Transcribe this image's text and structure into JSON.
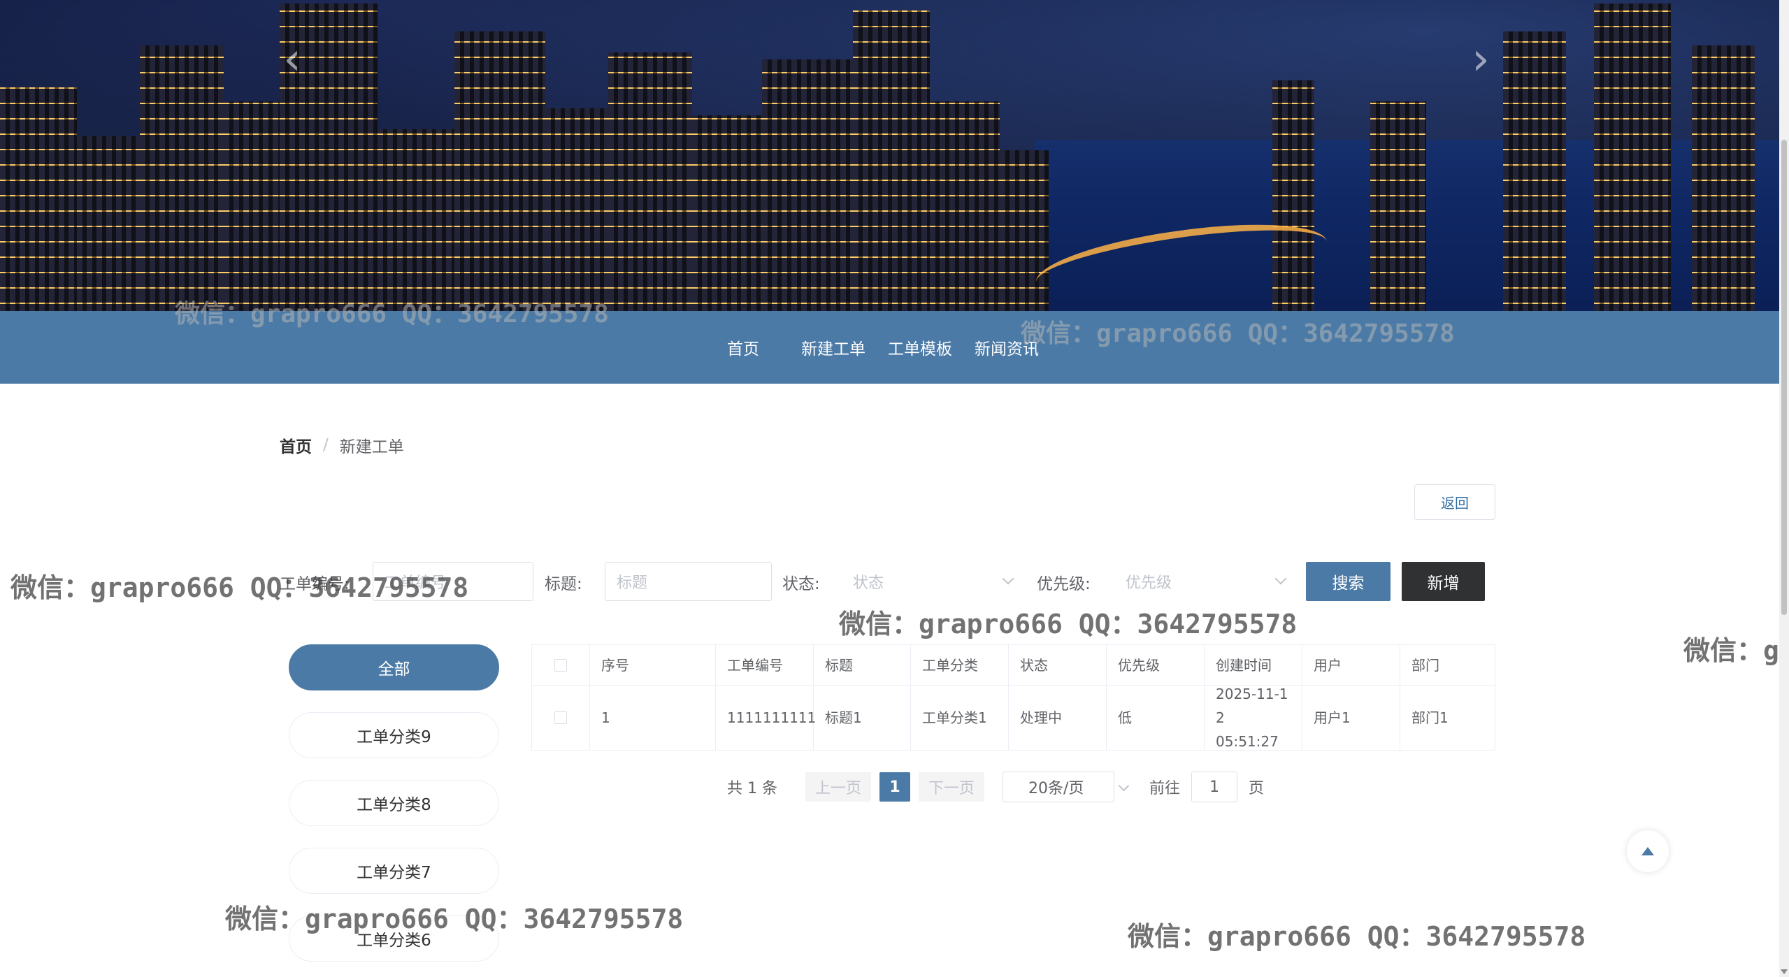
{
  "nav": {
    "items": [
      "首页",
      "新建工单",
      "工单模板",
      "新闻资讯"
    ]
  },
  "breadcrumb": {
    "home": "首页",
    "separator": "/",
    "current": "新建工单"
  },
  "actions": {
    "back_label": "返回"
  },
  "search": {
    "order_no_label": "工单编号:",
    "order_no_placeholder": "工单编号",
    "title_label": "标题:",
    "title_placeholder": "标题",
    "status_label": "状态:",
    "status_placeholder": "状态",
    "priority_label": "优先级:",
    "priority_placeholder": "优先级",
    "search_button": "搜索",
    "add_button": "新增"
  },
  "categories": {
    "items": [
      "全部",
      "工单分类9",
      "工单分类8",
      "工单分类7",
      "工单分类6"
    ],
    "active_index": 0
  },
  "table": {
    "columns": [
      "序号",
      "工单编号",
      "标题",
      "工单分类",
      "状态",
      "优先级",
      "创建时间",
      "用户",
      "部门"
    ],
    "rows": [
      {
        "index": "1",
        "order_no": "1111111111",
        "title": "标题1",
        "category": "工单分类1",
        "status": "处理中",
        "priority": "低",
        "created_at_line1": "2025-11-1",
        "created_at_line2": "2 05:51:27",
        "user": "用户1",
        "department": "部门1"
      }
    ]
  },
  "pagination": {
    "total_text": "共 1 条",
    "prev_label": "上一页",
    "current_page": "1",
    "next_label": "下一页",
    "page_size": "20条/页",
    "jump_prefix": "前往",
    "jump_value": "1",
    "jump_suffix": "页"
  },
  "watermarks": [
    "微信：grapro666 QQ：3642795578",
    "微信：grapro666 QQ：3642795578",
    "微信：grapro666 QQ：3642795578",
    "微信：grapro666 QQ：3642795578",
    "微信：grapro666 QQ：3642795578",
    "微信：grapro666 QQ：3642795578",
    "微信：g"
  ],
  "colors": {
    "primary": "#4b7aa6",
    "dark_button": "#303133",
    "link": "#2e6da4"
  }
}
